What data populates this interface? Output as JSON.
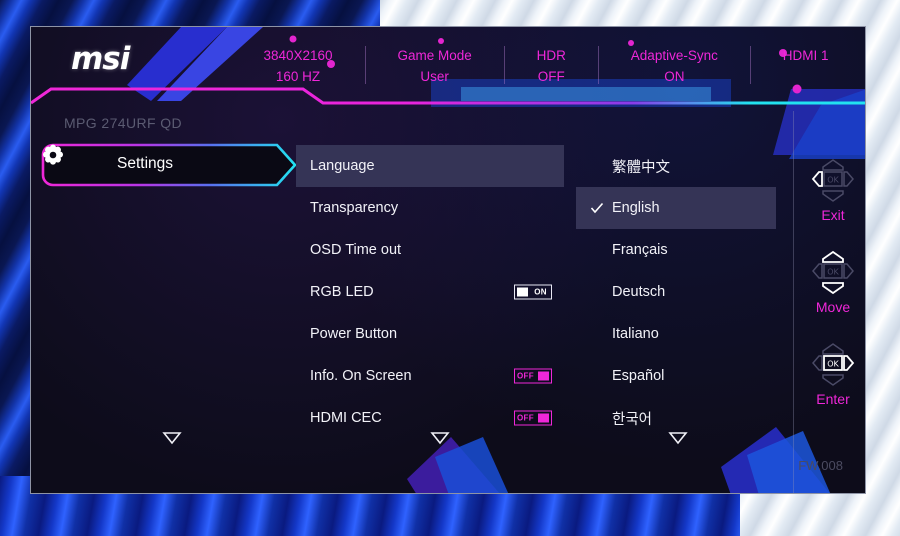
{
  "header": {
    "logo": "msi",
    "status_items": [
      {
        "name": "resolution",
        "line1": "3840X2160",
        "line2": "160 HZ"
      },
      {
        "name": "game-mode",
        "line1": "Game Mode",
        "line2": "User"
      },
      {
        "name": "hdr",
        "line1": "HDR",
        "line2": "OFF"
      },
      {
        "name": "adaptive-sync",
        "line1": "Adaptive-Sync",
        "line2": "ON"
      },
      {
        "name": "input-source",
        "line1": "HDMI 1",
        "line2": ""
      }
    ]
  },
  "model_name": "MPG 274URF QD",
  "tab": {
    "label": "Settings",
    "icon": "gear-icon"
  },
  "menu": {
    "items": [
      {
        "label": "Language",
        "selected": true,
        "toggle": null
      },
      {
        "label": "Transparency",
        "selected": false,
        "toggle": null
      },
      {
        "label": "OSD Time out",
        "selected": false,
        "toggle": null
      },
      {
        "label": "RGB LED",
        "selected": false,
        "toggle": "ON"
      },
      {
        "label": "Power Button",
        "selected": false,
        "toggle": null
      },
      {
        "label": "Info. On Screen",
        "selected": false,
        "toggle": "OFF"
      },
      {
        "label": "HDMI CEC",
        "selected": false,
        "toggle": "OFF"
      }
    ]
  },
  "languages": {
    "items": [
      {
        "label": "繁體中文",
        "selected": false
      },
      {
        "label": "English",
        "selected": true
      },
      {
        "label": "Français",
        "selected": false
      },
      {
        "label": "Deutsch",
        "selected": false
      },
      {
        "label": "Italiano",
        "selected": false
      },
      {
        "label": "Español",
        "selected": false
      },
      {
        "label": "한국어",
        "selected": false
      }
    ]
  },
  "nav_rail": {
    "items": [
      {
        "label": "Exit",
        "icon": "joystick-left-icon"
      },
      {
        "label": "Move",
        "icon": "joystick-updown-icon"
      },
      {
        "label": "Enter",
        "icon": "joystick-right-ok-icon"
      }
    ],
    "ok_text": "OK"
  },
  "footer": {
    "firmware": "FW.008",
    "scroll_arrows": 3
  },
  "colors": {
    "magenta": "#ef27d8",
    "cyan": "#22e2f0",
    "highlight": "#353456",
    "panel_bg": "#0d0c1a",
    "text": "#f2f2f8",
    "muted": "#5b5b72"
  }
}
